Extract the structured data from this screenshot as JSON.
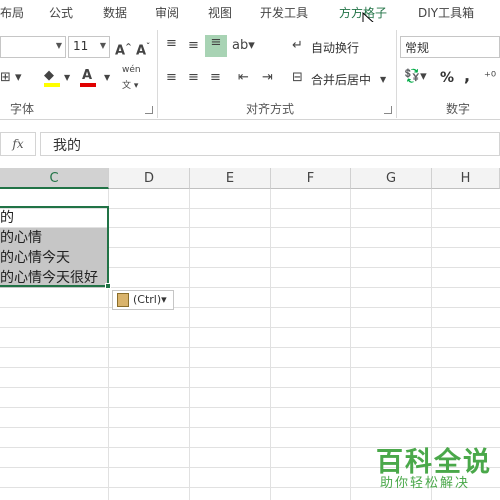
{
  "tabs": [
    "布局",
    "公式",
    "数据",
    "审阅",
    "视图",
    "开发工具",
    "方方格子",
    "DIY工具箱"
  ],
  "active_tab_index": 6,
  "font": {
    "size": "11",
    "group_label": "字体",
    "phonetic": "wén"
  },
  "alignment": {
    "wrap_text": "自动换行",
    "merge_center": "合并后居中",
    "group_label": "对齐方式"
  },
  "number": {
    "format": "常规",
    "percent": "%",
    "comma": ",",
    "group_label": "数字"
  },
  "formula_bar": {
    "fx": "fx",
    "content": "我的"
  },
  "columns": [
    "C",
    "D",
    "E",
    "F",
    "G",
    "H"
  ],
  "selected_column": "C",
  "cells": [
    {
      "text": "的",
      "highlighted": false
    },
    {
      "text": "的心情",
      "highlighted": true
    },
    {
      "text": "的心情今天",
      "highlighted": true
    },
    {
      "text": "的心情今天很好",
      "highlighted": true
    }
  ],
  "paste_options": {
    "label": "(Ctrl)",
    "arrow": "▾"
  },
  "watermark": {
    "title": "百科全说",
    "subtitle": "助你轻松解决"
  }
}
